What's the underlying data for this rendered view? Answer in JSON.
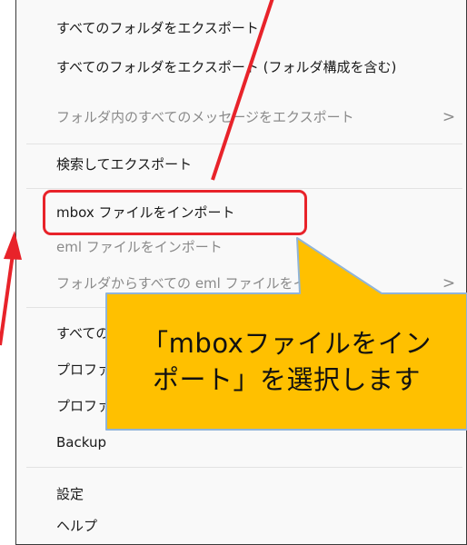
{
  "menu": {
    "items": [
      {
        "label": "すべてのフォルダをエクスポート",
        "enabled": true
      },
      {
        "label": "すべてのフォルダをエクスポート (フォルダ構成を含む)",
        "enabled": true
      },
      {
        "label": "フォルダ内のすべてのメッセージをエクスポート",
        "enabled": false,
        "submenu": true
      },
      {
        "label": "検索してエクスポート",
        "enabled": true
      },
      {
        "label": "mbox ファイルをインポート",
        "enabled": true,
        "highlighted": true
      },
      {
        "label": "eml ファイルをインポート",
        "enabled": false
      },
      {
        "label": "フォルダからすべての eml ファイルをインポート",
        "enabled": false,
        "submenu": true
      },
      {
        "label": "すべてのフォルダをバックアップ",
        "enabled": true
      },
      {
        "label": "プロファイルをバックアップ",
        "enabled": true
      },
      {
        "label": "プロファイルを復元",
        "enabled": true
      },
      {
        "label": "Backup",
        "enabled": true
      },
      {
        "label": "設定",
        "enabled": true
      },
      {
        "label": "ヘルプ",
        "enabled": true
      }
    ],
    "submenu_chevron": ">"
  },
  "callout": {
    "line1": "「mboxファイルをイン",
    "line2": "ポート」を選択します"
  },
  "colors": {
    "highlight_border": "#e8232a",
    "arrow": "#e8232a",
    "callout_fill": "#ffc000",
    "callout_border": "#90b4d8",
    "menu_background": "#f9f9f9",
    "disabled_text": "#8a8a8a"
  }
}
